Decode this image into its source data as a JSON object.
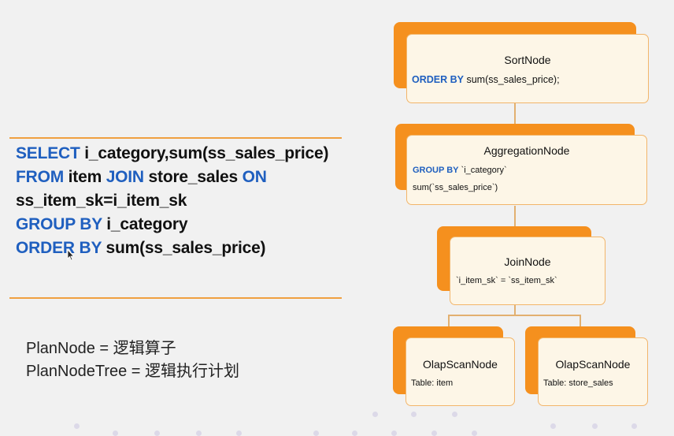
{
  "sql": {
    "line1": {
      "kw": "SELECT",
      "rest": " i_category,sum(ss_sales_price)"
    },
    "line2": {
      "kw1": "FROM",
      "mid": " item ",
      "kw2": "JOIN",
      "mid2": " store_sales ",
      "kw3": "ON"
    },
    "line3": {
      "rest": "ss_item_sk=i_item_sk"
    },
    "line4": {
      "kw": "GROUP BY",
      "rest": " i_category"
    },
    "line5": {
      "kw": "ORDER BY",
      "rest": " sum(ss_sales_price)"
    }
  },
  "definitions": {
    "plan_node": "PlanNode  = 逻辑算子",
    "plan_node_tree": "PlanNodeTree = 逻辑执行计划"
  },
  "tree": {
    "sort": {
      "title": "SortNode",
      "detail_kw": "ORDER BY",
      "detail": " sum(ss_sales_price);"
    },
    "aggregation": {
      "title": "AggregationNode",
      "detail_kw": "GROUP BY",
      "detail": " `i_category`",
      "detail2": "sum(`ss_sales_price`)"
    },
    "join": {
      "title": "JoinNode",
      "detail": "`i_item_sk` = `ss_item_sk`"
    },
    "scan_left": {
      "title": "OlapScanNode",
      "detail": "Table: item"
    },
    "scan_right": {
      "title": "OlapScanNode",
      "detail": "Table: store_sales"
    }
  },
  "colors": {
    "keyword": "#1f5fbf",
    "node_back": "#f5901e",
    "node_front": "#fdf6e7",
    "rule": "#f0a040"
  }
}
